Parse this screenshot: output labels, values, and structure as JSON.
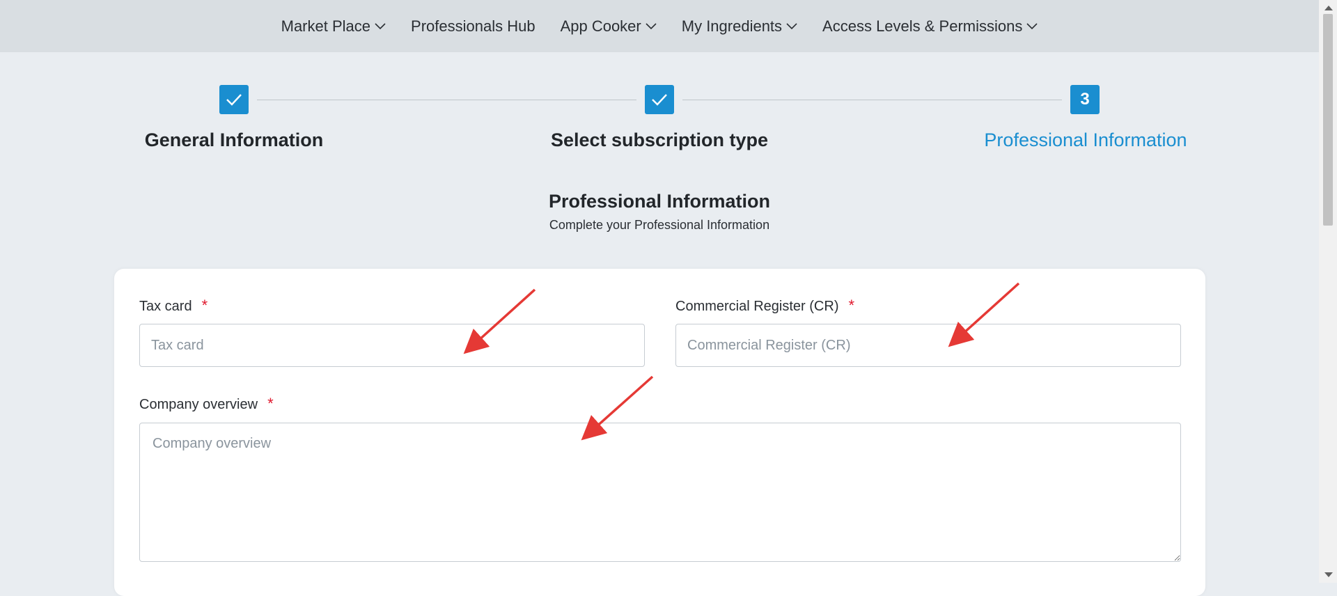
{
  "nav": {
    "items": [
      {
        "label": "Market Place",
        "dropdown": true
      },
      {
        "label": "Professionals Hub",
        "dropdown": false
      },
      {
        "label": "App Cooker",
        "dropdown": true
      },
      {
        "label": "My Ingredients",
        "dropdown": true
      },
      {
        "label": "Access Levels & Permissions",
        "dropdown": true
      }
    ]
  },
  "stepper": {
    "steps": [
      {
        "label": "General Information",
        "state": "done",
        "icon": "check-icon"
      },
      {
        "label": "Select subscription type",
        "state": "done",
        "icon": "check-icon"
      },
      {
        "label": "Professional Information",
        "state": "active",
        "number": "3"
      }
    ]
  },
  "section": {
    "title": "Professional Information",
    "subtitle": "Complete your Professional Information"
  },
  "form": {
    "tax_card": {
      "label": "Tax card",
      "placeholder": "Tax card",
      "value": "",
      "required_mark": "*"
    },
    "commercial_register": {
      "label": "Commercial Register (CR)",
      "placeholder": "Commercial Register (CR)",
      "value": "",
      "required_mark": "*"
    },
    "company_overview": {
      "label": "Company overview",
      "placeholder": "Company overview",
      "value": "",
      "required_mark": "*"
    }
  },
  "colors": {
    "accent": "#1a8ed0",
    "required": "#e0182d",
    "annotation_arrow": "#e53935",
    "nav_bg": "#d9dee2",
    "page_bg": "#e9edf1"
  }
}
